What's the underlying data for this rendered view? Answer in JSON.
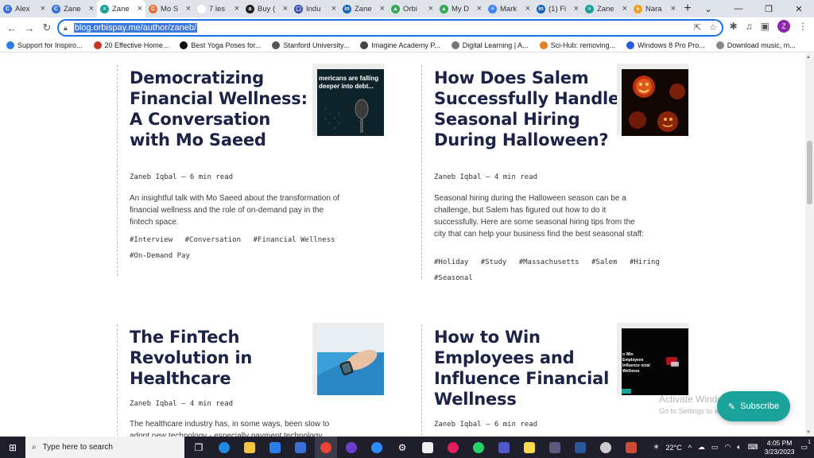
{
  "browser": {
    "tabs": [
      {
        "label": "Alex",
        "color": "#3b6fd8",
        "glyph": "C"
      },
      {
        "label": "Zane",
        "color": "#3b6fd8",
        "glyph": "C"
      },
      {
        "label": "Zane",
        "color": "#1aa39a",
        "glyph": "≈",
        "active": true
      },
      {
        "label": "Mo S",
        "color": "#e8703a",
        "glyph": "C"
      },
      {
        "label": "7 les",
        "color": "#ffffff",
        "glyph": ""
      },
      {
        "label": "Buy (",
        "color": "#222222",
        "glyph": "a"
      },
      {
        "label": "Indu",
        "color": "#3a4ea8",
        "glyph": "▢"
      },
      {
        "label": "Zane",
        "color": "#0a66c2",
        "glyph": "in"
      },
      {
        "label": "Orbi",
        "color": "#34a853",
        "glyph": "▲"
      },
      {
        "label": "My D",
        "color": "#34a853",
        "glyph": "▲"
      },
      {
        "label": "Mark",
        "color": "#4285f4",
        "glyph": "≡"
      },
      {
        "label": "(1) Fi",
        "color": "#0a66c2",
        "glyph": "in"
      },
      {
        "label": "Zane",
        "color": "#1aa39a",
        "glyph": "≈"
      },
      {
        "label": "Nara",
        "color": "#f0a020",
        "glyph": "♦"
      }
    ],
    "url": "blog.orbispay.me/author/zaneb/",
    "profile_initial": "Z",
    "bookmarks": [
      {
        "label": "Support for Inspiro...",
        "color": "#2b7de9"
      },
      {
        "label": "20 Effective Home...",
        "color": "#c0392b"
      },
      {
        "label": "Best Yoga Poses for...",
        "color": "#111111"
      },
      {
        "label": "Stanford University...",
        "color": "#555555"
      },
      {
        "label": "Imagine Academy P...",
        "color": "#444444"
      },
      {
        "label": "Digital Learning | A...",
        "color": "#777777"
      },
      {
        "label": "Sci-Hub: removing...",
        "color": "#e67e22"
      },
      {
        "label": "Windows 8 Pro Pro...",
        "color": "#2b5ce0"
      },
      {
        "label": "Download music, m...",
        "color": "#888888"
      }
    ]
  },
  "posts": [
    {
      "title": [
        "Democratizing",
        "Financial Wellness:",
        "A Conversation",
        "with Mo Saeed"
      ],
      "author": "Zaneb Iqbal",
      "read_time": "6 min read",
      "desc": "An insightful talk with Mo Saeed about the transformation of financial wellness and the role of on-demand pay in the fintech space.",
      "tags": [
        "#Interview",
        "#Conversation",
        "#Financial Wellness",
        "#On-Demand Pay"
      ],
      "thumb_text": "mericans are falling deeper into debt..."
    },
    {
      "title": [
        "How Does Salem",
        "Successfully Handle",
        "Seasonal Hiring",
        "During Halloween?"
      ],
      "author": "Zaneb Iqbal",
      "read_time": "4 min read",
      "desc": "Seasonal hiring during the Halloween season can be a challenge, but Salem has figured out how to do it successfully. Here are some seasonal hiring tips from the city that can help your business find the best seasonal staff:",
      "tags": [
        "#Holiday",
        "#Study",
        "#Massachusetts",
        "#Salem",
        "#Hiring",
        "#Seasonal"
      ]
    },
    {
      "title": [
        "The FinTech",
        "Revolution in",
        "Healthcare"
      ],
      "author": "Zaneb Iqbal",
      "read_time": "4 min read",
      "desc": "The healthcare industry has, in some ways, been slow to adopt new technology - especially payment technology."
    },
    {
      "title": [
        "How to Win",
        "Employees and",
        "Influence Financial",
        "Wellness"
      ],
      "author": "Zaneb Iqbal",
      "read_time": "6 min read",
      "thumb_text": "o Win Employees Influence ncial Wellness"
    }
  ],
  "meta_separator": "—",
  "overlay": {
    "activate_title": "Activate Windows",
    "activate_sub": "Go to Settings to activate Windows.",
    "subscribe_label": "Subscribe"
  },
  "taskbar": {
    "search_placeholder": "Type here to search",
    "weather": "22°C",
    "time": "4:05 PM",
    "date": "3/23/2023",
    "notification_count": "1"
  }
}
